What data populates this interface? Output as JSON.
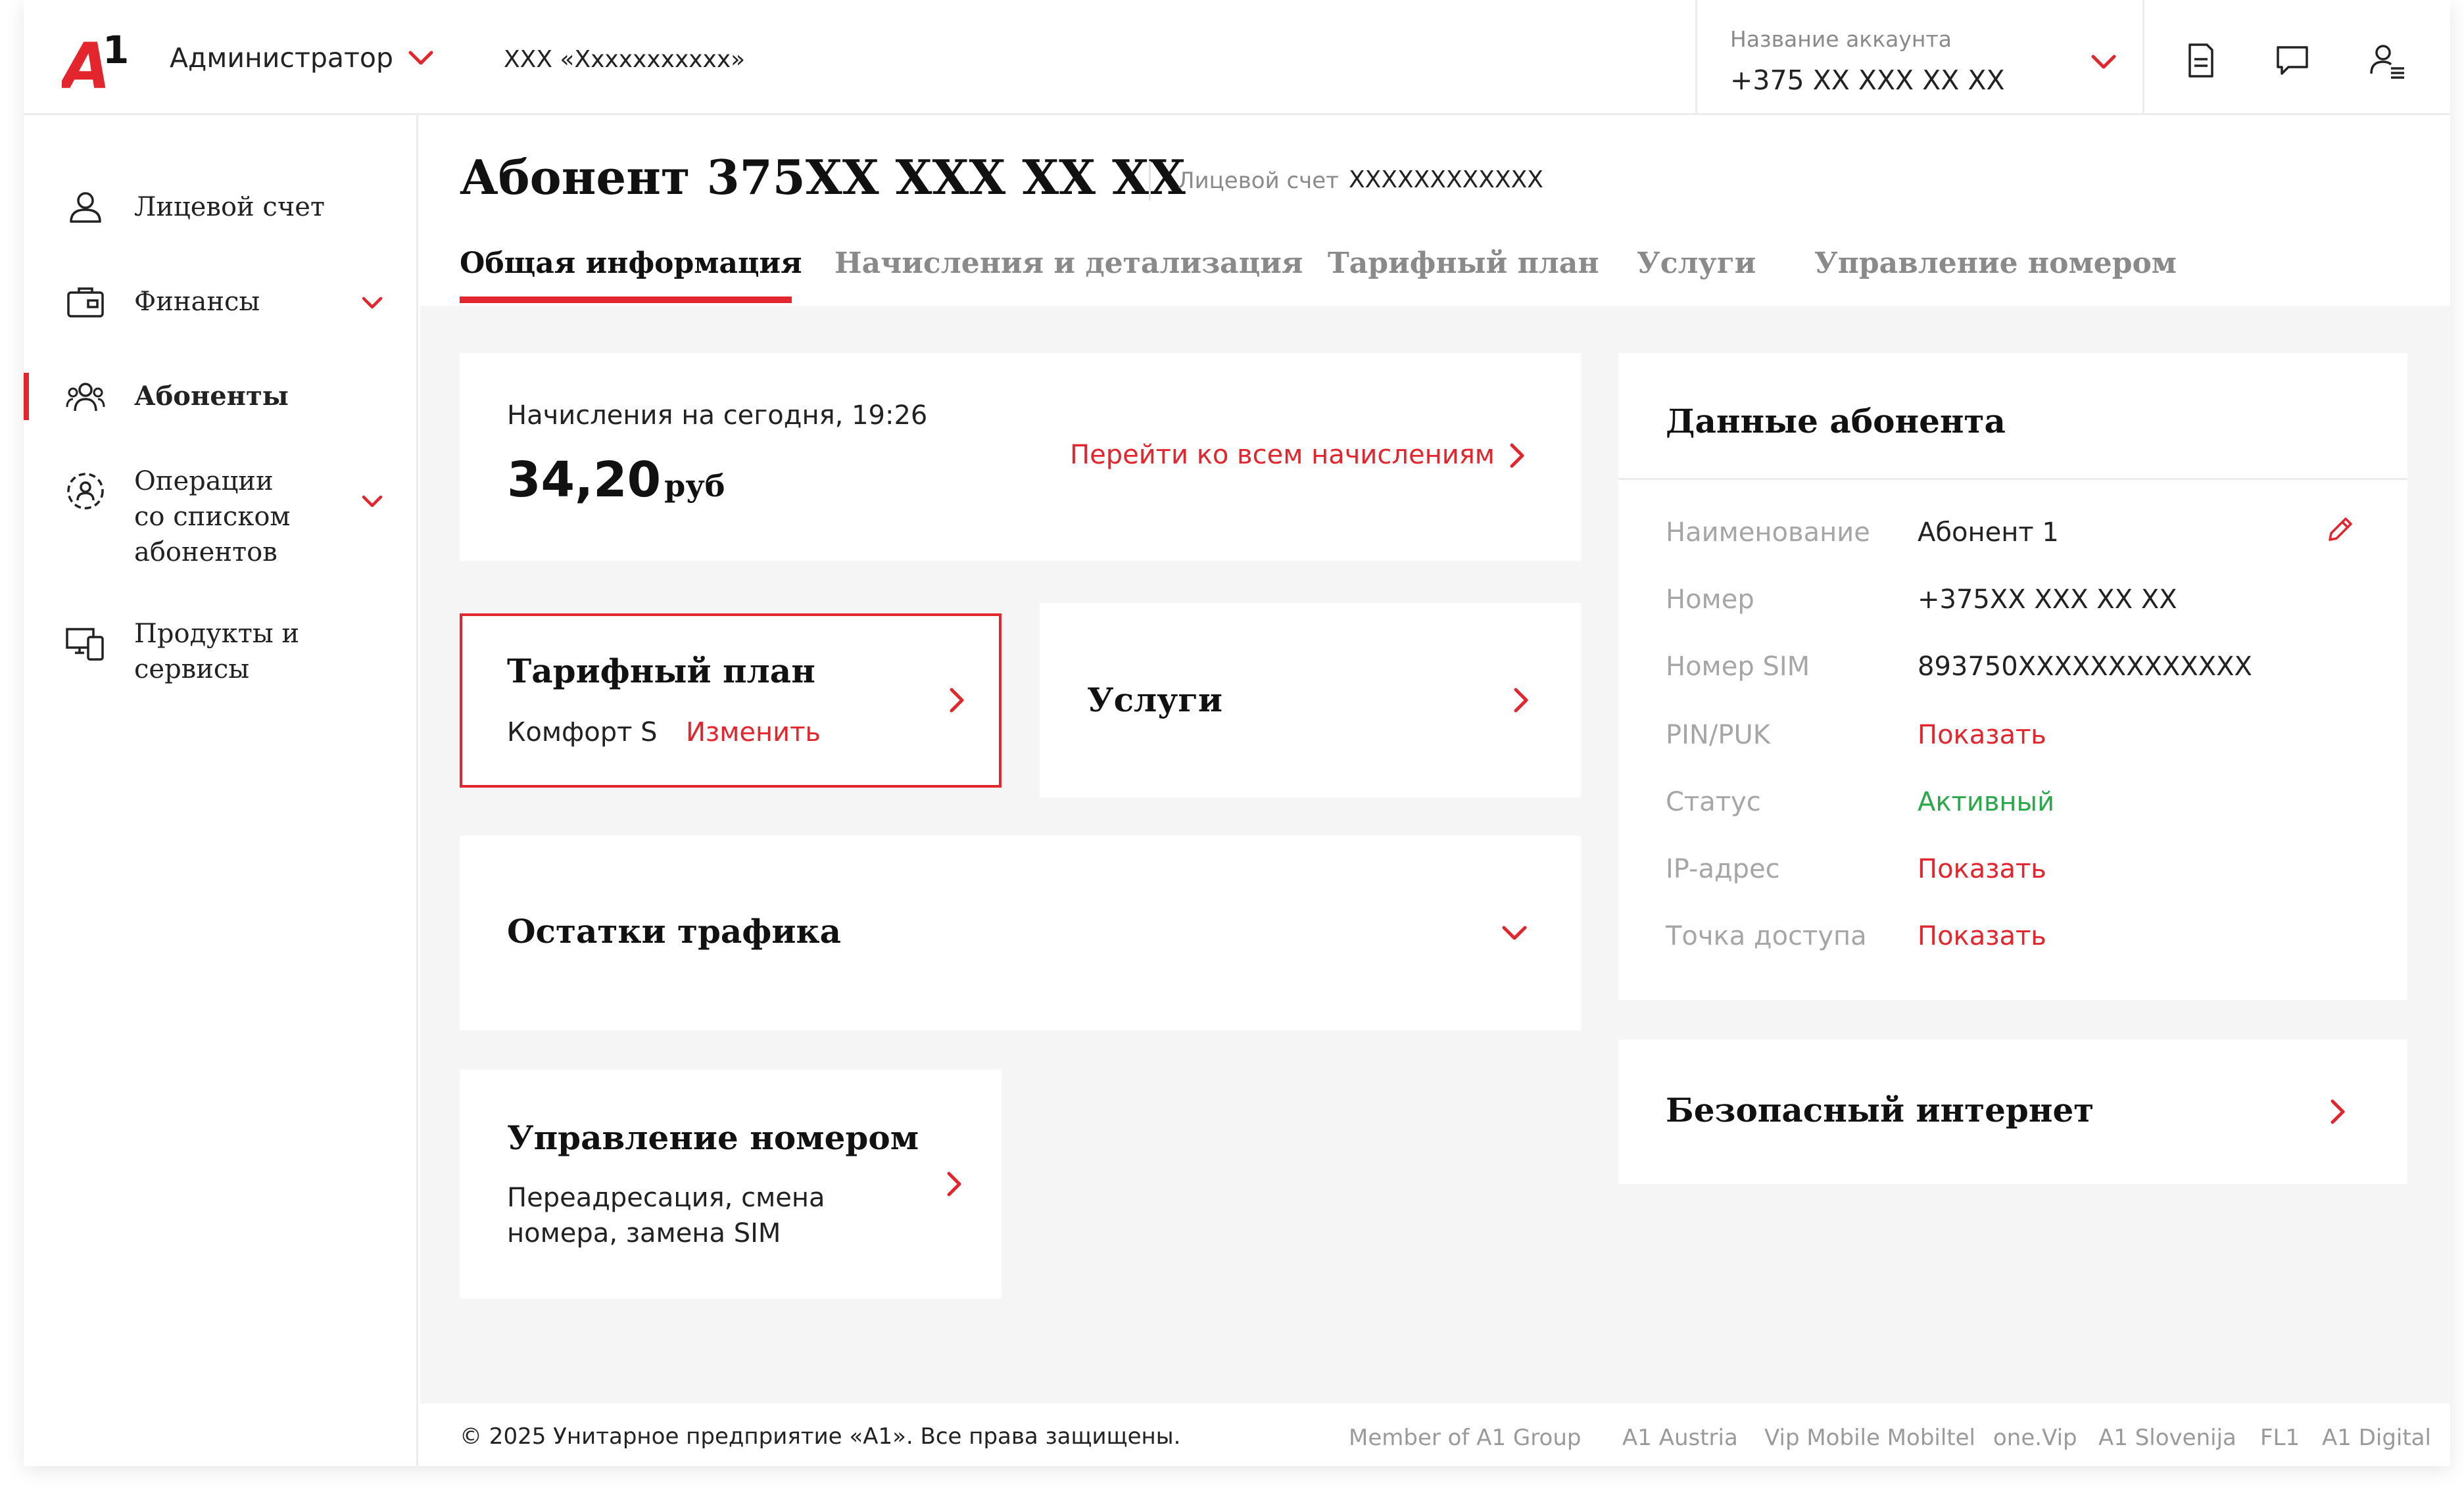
{
  "header": {
    "logo_text": "A1",
    "role": "Администратор",
    "org": "XXX «Xxxxxxxxxxx»",
    "account_label": "Название аккаунта",
    "account_number": "+375 XX XXX XX XX",
    "icons": [
      "document-icon",
      "chat-icon",
      "user-menu-icon"
    ]
  },
  "sidebar": {
    "items": [
      {
        "label": "Лицевой счет",
        "icon": "person-icon"
      },
      {
        "label": "Финансы",
        "icon": "wallet-icon"
      },
      {
        "label": "Абоненты",
        "icon": "group-icon"
      },
      {
        "label_lines": [
          "Операции",
          "со списком",
          "абонентов"
        ],
        "icon": "group-circle-icon"
      },
      {
        "label_lines": [
          "Продукты и",
          "сервисы"
        ],
        "icon": "devices-icon"
      }
    ]
  },
  "page": {
    "title": "Абонент 375XX XXX XX XX",
    "ls_label": "Лицевой счет",
    "ls_value": "XXXXXXXXXXXX",
    "tabs": [
      "Общая информация",
      "Начисления и детализация",
      "Тарифный план",
      "Услуги",
      "Управление номером"
    ]
  },
  "charges": {
    "label": "Начисления на сегодня, 19:26",
    "amount": "34,20",
    "currency": "руб",
    "link": "Перейти ко всем начислениям"
  },
  "tariff": {
    "title": "Тарифный план",
    "plan": "Комфорт S",
    "change": "Изменить"
  },
  "services": {
    "title": "Услуги"
  },
  "traffic": {
    "title": "Остатки трафика"
  },
  "number_mgmt": {
    "title": "Управление номером",
    "desc_lines": [
      "Переадресация, смена",
      "номера, замена SIM"
    ]
  },
  "subscriber": {
    "title": "Данные абонента",
    "rows": [
      {
        "label": "Наименование",
        "value": "Абонент 1"
      },
      {
        "label": "Номер",
        "value": "+375XX XXX XX XX"
      },
      {
        "label": "Номер SIM",
        "value": "893750XXXXXXXXXXXXX"
      },
      {
        "label": "PIN/PUK",
        "value": "Показать"
      },
      {
        "label": "Статус",
        "value": "Активный"
      },
      {
        "label": "IP-адрес",
        "value": "Показать"
      },
      {
        "label": "Точка доступа",
        "value": "Показать"
      }
    ]
  },
  "safe_internet": {
    "title": "Безопасный интернет"
  },
  "footer": {
    "copyright": "© 2025 Унитарное предприятие «А1». Все права защищены.",
    "links": [
      "Member of A1 Group",
      "A1 Austria",
      "Vip Mobile Mobiltel",
      "one.Vip",
      "A1 Slovenija",
      "FL1",
      "A1 Digital"
    ]
  },
  "colors": {
    "accent": "#e3262d",
    "active_status": "#2aa84a",
    "muted": "#a6a6a6",
    "background": "#f5f5f5"
  }
}
